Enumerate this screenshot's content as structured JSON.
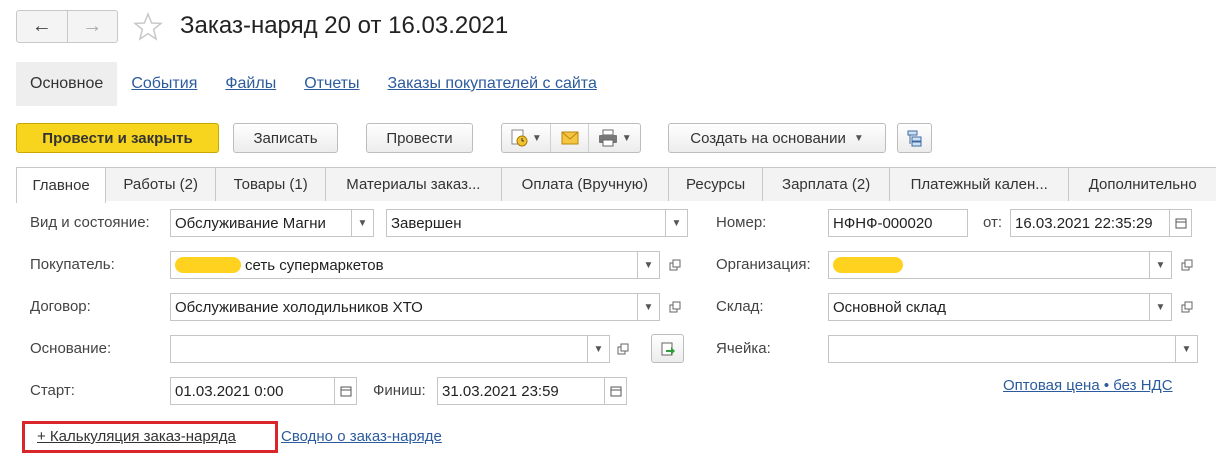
{
  "window": {
    "title": "Заказ-наряд 20 от 16.03.2021"
  },
  "nav": {
    "back_icon": "arrow-left-icon",
    "forward_icon": "arrow-right-icon",
    "favorite_icon": "star-icon"
  },
  "top_links": {
    "active": "Основное",
    "items": [
      "События",
      "Файлы",
      "Отчеты",
      "Заказы покупателей с сайта"
    ]
  },
  "toolbar": {
    "post_close": "Провести и закрыть",
    "save": "Записать",
    "post": "Провести",
    "create_based": "Создать на основании"
  },
  "tabs": [
    "Главное",
    "Работы (2)",
    "Товары (1)",
    "Материалы заказ...",
    "Оплата (Вручную)",
    "Ресурсы",
    "Зарплата (2)",
    "Платежный кален...",
    "Дополнительно"
  ],
  "form": {
    "kind_label": "Вид и состояние:",
    "kind_value": "Обслуживание Магни",
    "state_value": "Завершен",
    "number_label": "Номер:",
    "number_value": "НФНФ-000020",
    "from_label": "от:",
    "from_value": "16.03.2021 22:35:29",
    "buyer_label": "Покупатель:",
    "buyer_value": "сеть супермаркетов",
    "org_label": "Организация:",
    "contract_label": "Договор:",
    "contract_value": "Обслуживание холодильников ХТО",
    "warehouse_label": "Склад:",
    "warehouse_value": "Основной склад",
    "basis_label": "Основание:",
    "basis_value": "",
    "cell_label": "Ячейка:",
    "cell_value": "",
    "start_label": "Старт:",
    "start_value": "01.03.2021  0:00",
    "finish_label": "Финиш:",
    "finish_value": "31.03.2021 23:59",
    "price_link": "Оптовая цена • без НДС",
    "calc_link": "+ Калькуляция заказ-наряда",
    "summary_link": "Сводно о заказ-наряде"
  },
  "colors": {
    "primary": "#f7d51e",
    "link": "#2c5b9d",
    "highlight_box": "#d9262b",
    "redaction": "#ffd21f"
  }
}
